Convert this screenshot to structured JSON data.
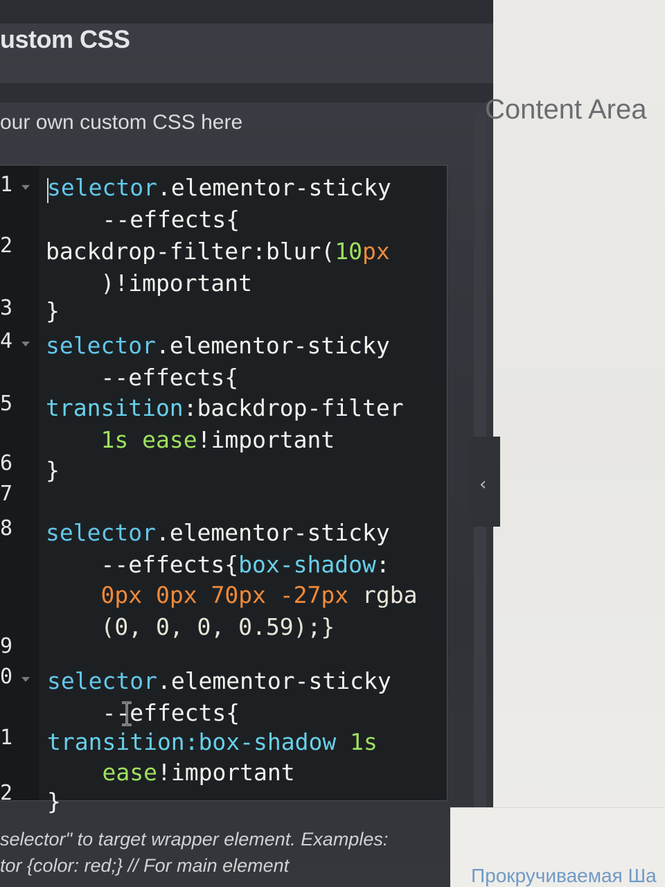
{
  "panel": {
    "title": "ustom CSS",
    "description": "our own custom CSS here"
  },
  "content_area_label": "Content Area",
  "editor": {
    "line_numbers": [
      "1",
      "2",
      "3",
      "4",
      "5",
      "6",
      "7",
      "8",
      "9",
      "0",
      "1",
      "2"
    ],
    "lines": [
      [
        {
          "t": "selector",
          "c": "sel"
        },
        {
          "t": ".elementor-sticky",
          "c": "plain"
        }
      ],
      [
        {
          "t": "    --effects{",
          "c": "plain"
        }
      ],
      [
        {
          "t": "backdrop-filter:blur(",
          "c": "plain"
        },
        {
          "t": "10",
          "c": "grn"
        },
        {
          "t": "px",
          "c": "num"
        }
      ],
      [
        {
          "t": "    )!important",
          "c": "plain"
        }
      ],
      [
        {
          "t": "}",
          "c": "plain"
        }
      ],
      [
        {
          "t": "selector",
          "c": "sel"
        },
        {
          "t": ".elementor-sticky",
          "c": "plain"
        }
      ],
      [
        {
          "t": "    --effects{",
          "c": "plain"
        }
      ],
      [
        {
          "t": "transition",
          "c": "prop"
        },
        {
          "t": ":backdrop-filter",
          "c": "plain"
        }
      ],
      [
        {
          "t": "    ",
          "c": "plain"
        },
        {
          "t": "1s",
          "c": "grn"
        },
        {
          "t": " ",
          "c": "plain"
        },
        {
          "t": "ease",
          "c": "grn"
        },
        {
          "t": "!important",
          "c": "plain"
        }
      ],
      [
        {
          "t": "}",
          "c": "plain"
        }
      ],
      [
        {
          "t": "selector",
          "c": "sel"
        },
        {
          "t": ".elementor-sticky",
          "c": "plain"
        }
      ],
      [
        {
          "t": "    --effects{",
          "c": "plain"
        },
        {
          "t": "box-shadow",
          "c": "prop"
        },
        {
          "t": ":",
          "c": "plain"
        }
      ],
      [
        {
          "t": "    ",
          "c": "plain"
        },
        {
          "t": "0px",
          "c": "num"
        },
        {
          "t": " ",
          "c": "plain"
        },
        {
          "t": "0px",
          "c": "num"
        },
        {
          "t": " ",
          "c": "plain"
        },
        {
          "t": "70px",
          "c": "num"
        },
        {
          "t": " ",
          "c": "plain"
        },
        {
          "t": "-27px",
          "c": "num"
        },
        {
          "t": " rgba",
          "c": "val"
        }
      ],
      [
        {
          "t": "    (0, 0, 0, 0.59);}",
          "c": "val"
        }
      ],
      [
        {
          "t": "selector",
          "c": "sel"
        },
        {
          "t": ".elementor-sticky",
          "c": "plain"
        }
      ],
      [
        {
          "t": "    --effects{",
          "c": "plain"
        }
      ],
      [
        {
          "t": "transition",
          "c": "prop"
        },
        {
          "t": ":box-shadow ",
          "c": "prop"
        },
        {
          "t": "1s",
          "c": "grn"
        }
      ],
      [
        {
          "t": "    ",
          "c": "plain"
        },
        {
          "t": "ease",
          "c": "grn"
        },
        {
          "t": "!important",
          "c": "plain"
        }
      ],
      [
        {
          "t": "}",
          "c": "plain"
        }
      ]
    ]
  },
  "hints": [
    "selector\" to target wrapper element. Examples:",
    "tor {color: red;} // For main element"
  ],
  "bottom_right_text": "Прокручиваемая Ша",
  "colors": {
    "selector": "#62c7e9",
    "property": "#68d0ea",
    "number": "#f08a3a",
    "keyword": "#9fe05e",
    "text": "#f2f2ee"
  },
  "icons": {
    "collapse": "chevron-left-icon",
    "fold": "fold-arrow-icon",
    "cursor": "text-cursor-icon"
  }
}
